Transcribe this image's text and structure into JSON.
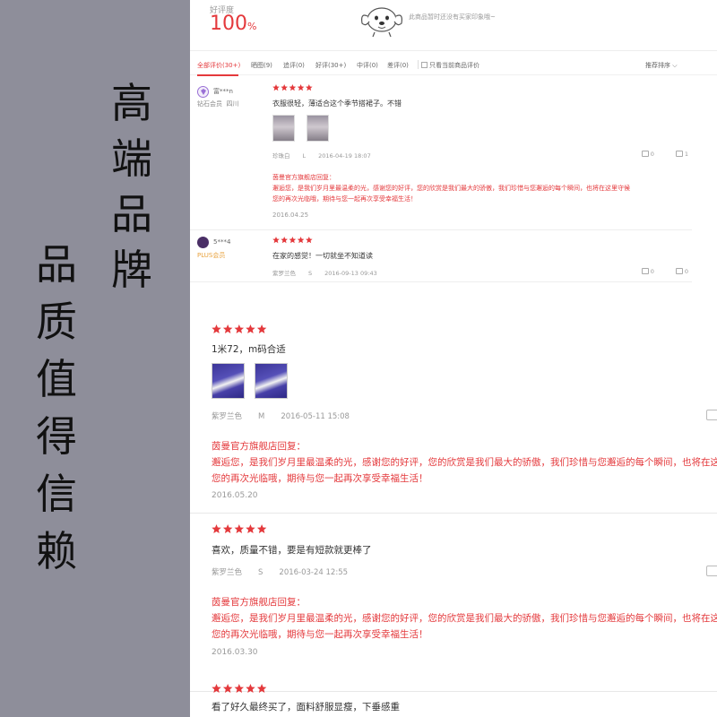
{
  "banner": {
    "brand_chars": [
      "高",
      "端",
      "品",
      "牌"
    ],
    "quality_chars": [
      "品",
      "质",
      "值",
      "得",
      "信",
      "赖"
    ]
  },
  "rating": {
    "label": "好评度",
    "value": "100",
    "unit": "%",
    "no_impression": "此商品暂时还没有买家印象哦~"
  },
  "tabs": {
    "all": "全部评价(30+)",
    "photos": "晒图(9)",
    "followup": "追评(0)",
    "good": "好评(30+)",
    "medium": "中评(0)",
    "bad": "差评(0)",
    "current_only": "只看当前商品评价",
    "sort": "推荐排序"
  },
  "colors": {
    "accent": "#e4393c",
    "banner_gray": "#8e8e9a"
  },
  "reviews_small": [
    {
      "user": "富***n",
      "level": "钻石会员",
      "region": "四川",
      "content": "衣服很轻，薄适合这个季节搭裙子。不错",
      "color": "珍珠白",
      "size": "L",
      "date": "2016-04-19 18:07",
      "likes": "0",
      "comments": "1",
      "reply_title": "茵曼官方旗舰店回复：",
      "reply_line1": "邂逅您，是我们岁月里最温柔的光，感谢您的好评，您的欣赏是我们最大的骄傲，我们珍惜与您邂逅的每个瞬间，也将在这里守候",
      "reply_line2": "您的再次光临哦，期待与您一起再次享受幸福生活！",
      "reply_date": "2016.04.25"
    },
    {
      "user": "5***4",
      "level": "PLUS会员",
      "content": "在家的感觉！一切就坐不知道读",
      "color": "紫罗兰色",
      "size": "S",
      "date": "2016-09-13 09:43",
      "likes": "0",
      "comments": "0"
    }
  ],
  "reviews_large": [
    {
      "content": "1米72，m码合适",
      "color": "紫罗兰色",
      "size": "M",
      "date": "2016-05-11 15:08",
      "reply_title": "茵曼官方旗舰店回复：",
      "reply_line1": "邂逅您，是我们岁月里最温柔的光，感谢您的好评，您的欣赏是我们最大的骄傲，我们珍惜与您邂逅的每个瞬间，也将在这里守候",
      "reply_line2": "您的再次光临哦，期待与您一起再次享受幸福生活！",
      "reply_date": "2016.05.20"
    },
    {
      "content": "喜欢，质量不错，要是有短款就更棒了",
      "color": "紫罗兰色",
      "size": "S",
      "date": "2016-03-24 12:55",
      "reply_title": "茵曼官方旗舰店回复：",
      "reply_line1": "邂逅您，是我们岁月里最温柔的光，感谢您的好评，您的欣赏是我们最大的骄傲，我们珍惜与您邂逅的每个瞬间，也将在这里守候",
      "reply_line2": "您的再次光临哦，期待与您一起再次享受幸福生活！",
      "reply_date": "2016.03.30"
    },
    {
      "content": "看了好久最终买了，面料舒服显瘦，下垂感重"
    }
  ]
}
